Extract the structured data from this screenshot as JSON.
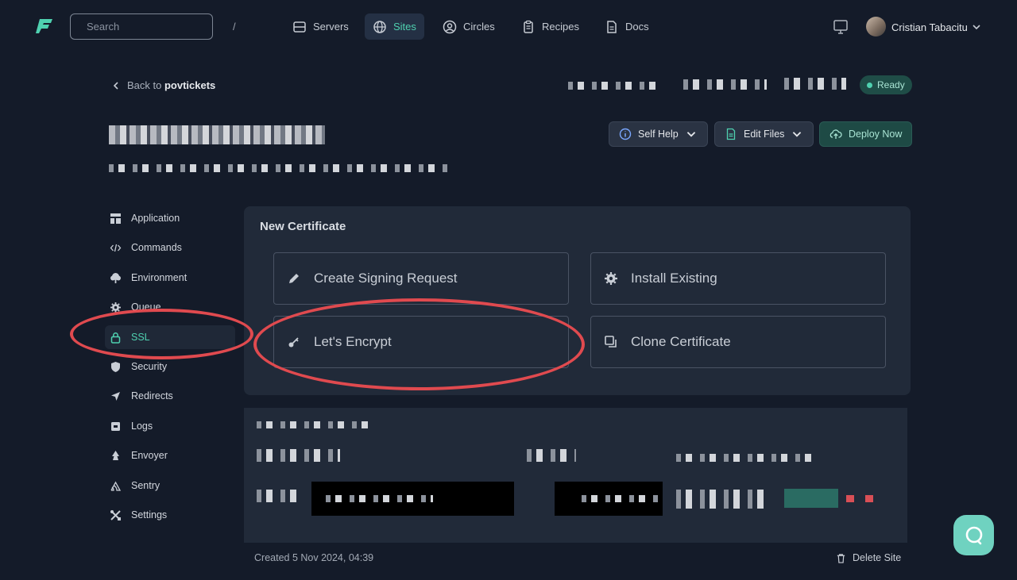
{
  "header": {
    "search_placeholder": "Search",
    "search_shortcut": "/",
    "nav": [
      {
        "label": "Servers",
        "icon": "server-icon"
      },
      {
        "label": "Sites",
        "icon": "globe-icon",
        "active": true
      },
      {
        "label": "Circles",
        "icon": "user-circle-icon"
      },
      {
        "label": "Recipes",
        "icon": "clipboard-icon"
      },
      {
        "label": "Docs",
        "icon": "document-icon"
      }
    ],
    "user_name": "Cristian Tabacitu"
  },
  "site": {
    "back_prefix": "Back to",
    "back_target": "povtickets",
    "status": "Ready",
    "status_color": "#4fd1b0",
    "buttons": {
      "self_help": "Self Help",
      "edit_files": "Edit Files",
      "deploy_now": "Deploy Now"
    }
  },
  "sidebar": {
    "items": [
      {
        "label": "Application",
        "icon": "layout-icon"
      },
      {
        "label": "Commands",
        "icon": "code-icon"
      },
      {
        "label": "Environment",
        "icon": "tree-icon"
      },
      {
        "label": "Queue",
        "icon": "gear-icon"
      },
      {
        "label": "SSL",
        "icon": "lock-icon",
        "active": true
      },
      {
        "label": "Security",
        "icon": "shield-icon"
      },
      {
        "label": "Redirects",
        "icon": "arrow-icon"
      },
      {
        "label": "Logs",
        "icon": "logs-icon"
      },
      {
        "label": "Envoyer",
        "icon": "rocket-icon"
      },
      {
        "label": "Sentry",
        "icon": "sentry-icon"
      },
      {
        "label": "Settings",
        "icon": "tools-icon"
      }
    ]
  },
  "certificate": {
    "title": "New Certificate",
    "options": [
      {
        "label": "Create Signing Request",
        "icon": "pencil-icon"
      },
      {
        "label": "Install Existing",
        "icon": "gear-icon"
      },
      {
        "label": "Let's Encrypt",
        "icon": "key-icon"
      },
      {
        "label": "Clone Certificate",
        "icon": "copy-icon"
      }
    ]
  },
  "footer": {
    "created": "Created 5 Nov 2024, 04:39",
    "delete_label": "Delete Site"
  },
  "colors": {
    "accent": "#4fd1b0",
    "background": "#141b29",
    "annotation": "#e04a4f"
  }
}
